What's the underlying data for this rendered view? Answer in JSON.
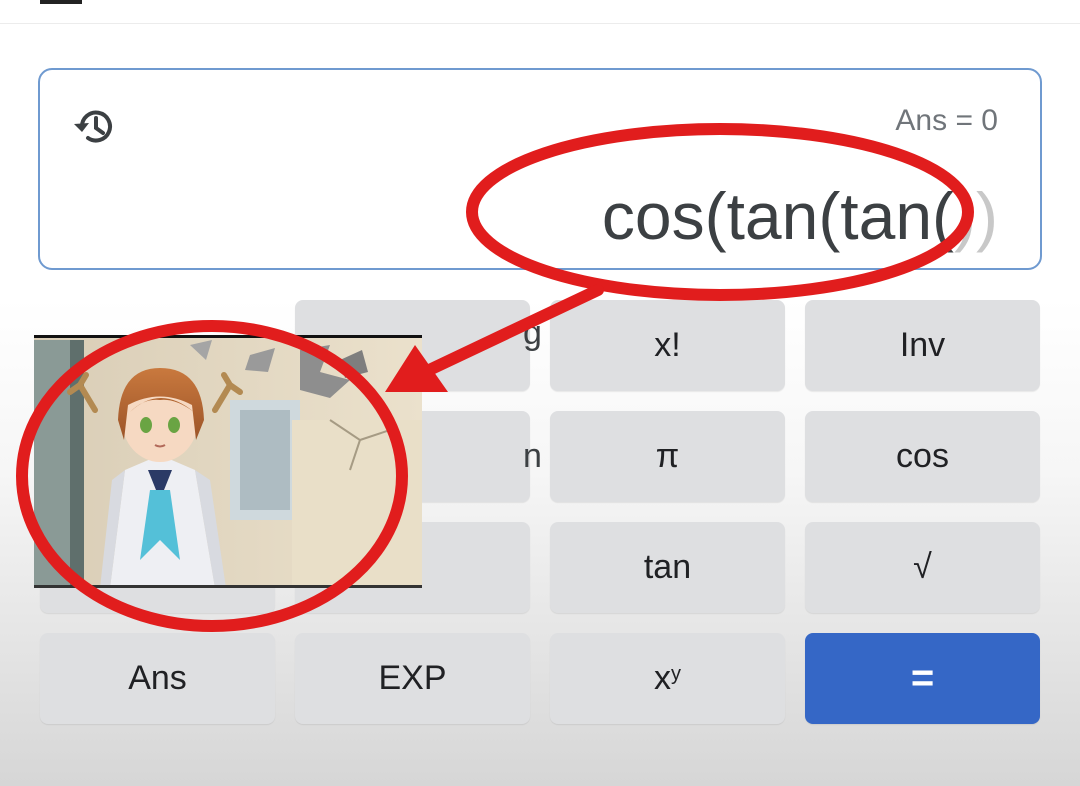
{
  "display": {
    "answer_line": "Ans = 0",
    "expression": "cos(tan(tan(",
    "expression_ghost": "))"
  },
  "keys": {
    "row1": {
      "k1_partial": "g",
      "k2": "x!",
      "k3": "Inv"
    },
    "row2": {
      "k1_partial": "n",
      "k2": "π",
      "k3": "cos"
    },
    "row3": {
      "k2": "tan",
      "k3": "√"
    },
    "row4": {
      "k0": "Ans",
      "k1": "EXP",
      "k2_base": "x",
      "k2_sup": "y",
      "k3": "="
    }
  },
  "colors": {
    "annotation_red": "#e11d1d",
    "equals_blue": "#3567c6",
    "key_gray": "#dedfe1",
    "display_border": "#6f9ad0"
  },
  "icons": [
    "history-icon"
  ],
  "overlay_image": "anime-girl-meme-image"
}
